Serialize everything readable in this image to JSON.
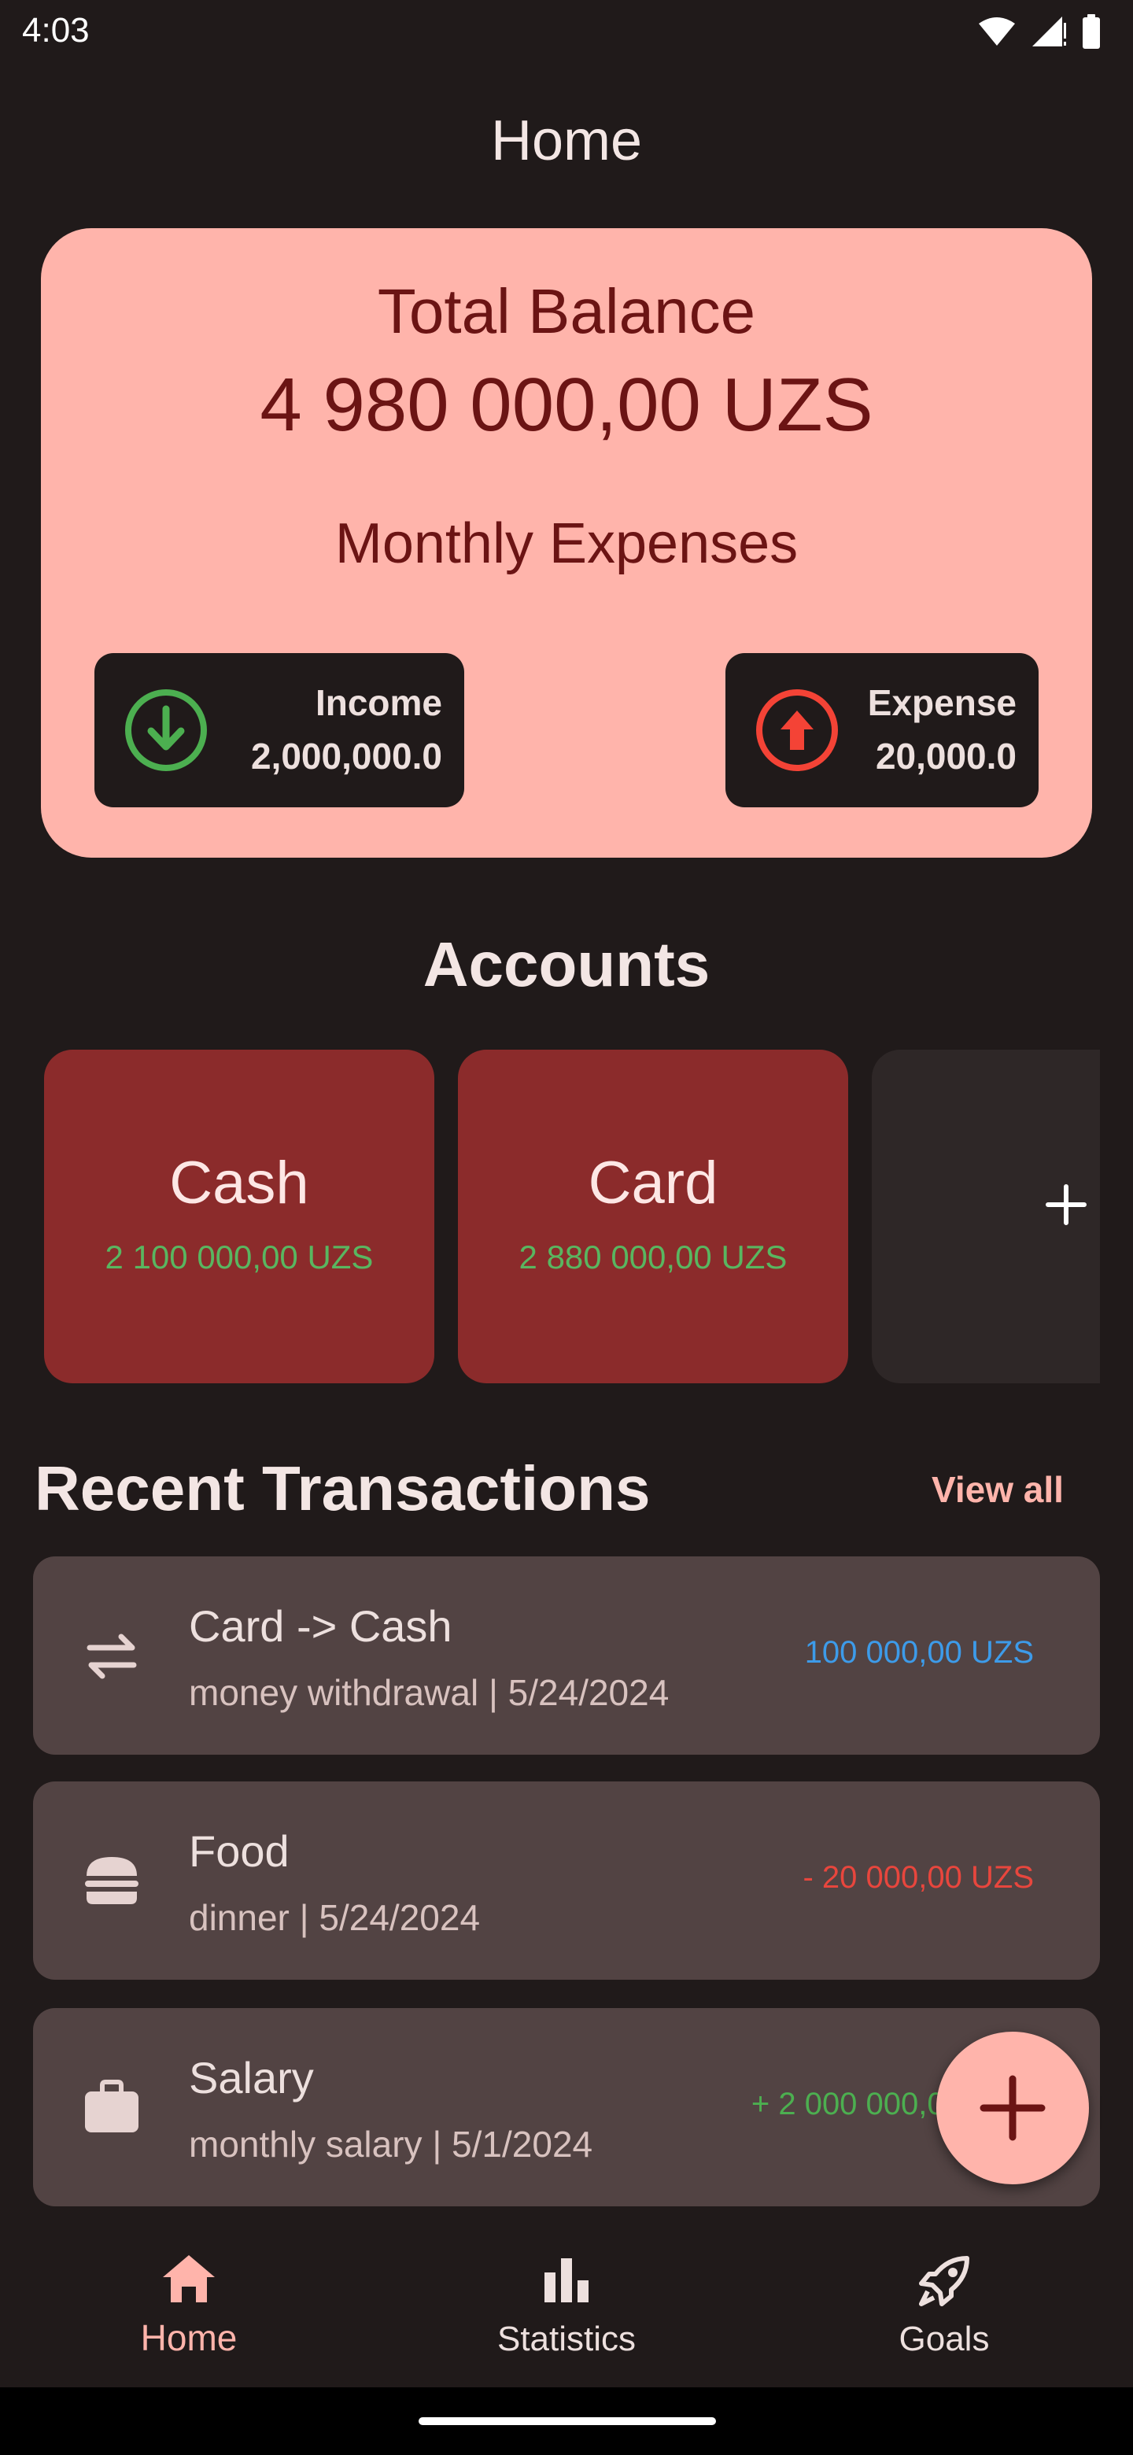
{
  "status_bar": {
    "time": "4:03"
  },
  "header": {
    "title": "Home"
  },
  "balance_card": {
    "title": "Total Balance",
    "amount": "4 980 000,00 UZS",
    "monthly_label": "Monthly Expenses",
    "income": {
      "label": "Income",
      "amount": "2,000,000.0",
      "icon": "arrow-down-circle-icon",
      "color": "#4caf50"
    },
    "expense": {
      "label": "Expense",
      "amount": "20,000.0",
      "icon": "arrow-up-circle-icon",
      "color": "#f44336"
    }
  },
  "accounts": {
    "title": "Accounts",
    "items": [
      {
        "name": "Cash",
        "balance": "2 100 000,00 UZS"
      },
      {
        "name": "Card",
        "balance": "2 880 000,00 UZS"
      }
    ],
    "add_icon": "plus-icon"
  },
  "recent": {
    "title": "Recent Transactions",
    "view_all": "View all",
    "items": [
      {
        "icon": "transfer-icon",
        "title": "Card -> Cash",
        "subtitle": "money withdrawal  | 5/24/2024",
        "amount": "100 000,00 UZS",
        "color": "#3d9be9"
      },
      {
        "icon": "burger-icon",
        "title": "Food",
        "subtitle": "dinner | 5/24/2024",
        "amount": "- 20 000,00 UZS",
        "color": "#e8463d"
      },
      {
        "icon": "briefcase-icon",
        "title": "Salary",
        "subtitle": "monthly salary | 5/1/2024",
        "amount": "+ 2 000 000,00 UZS",
        "color": "#4caf50"
      }
    ]
  },
  "fab": {
    "icon": "plus-icon"
  },
  "bottom_nav": {
    "items": [
      {
        "label": "Home",
        "icon": "home-icon",
        "active": true
      },
      {
        "label": "Statistics",
        "icon": "bar-chart-icon",
        "active": false
      },
      {
        "label": "Goals",
        "icon": "rocket-icon",
        "active": false
      }
    ]
  },
  "colors": {
    "background": "#201a1a",
    "card_pink": "#ffb4ab",
    "account_red": "#8b2b2b",
    "transaction_bg": "#524343"
  }
}
